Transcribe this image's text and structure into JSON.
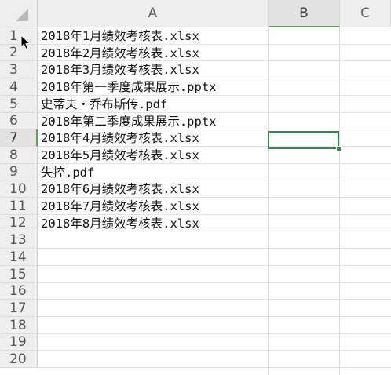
{
  "columns": [
    "A",
    "B",
    "C"
  ],
  "selected_column": "B",
  "rows": [
    {
      "num": "1",
      "a": "2018年1月绩效考核表.xlsx"
    },
    {
      "num": "2",
      "a": "2018年2月绩效考核表.xlsx"
    },
    {
      "num": "3",
      "a": "2018年3月绩效考核表.xlsx"
    },
    {
      "num": "4",
      "a": "2018年第一季度成果展示.pptx"
    },
    {
      "num": "5",
      "a": "史蒂夫・乔布斯传.pdf"
    },
    {
      "num": "6",
      "a": "2018年第二季度成果展示.pptx"
    },
    {
      "num": "7",
      "a": "2018年4月绩效考核表.xlsx"
    },
    {
      "num": "8",
      "a": "2018年5月绩效考核表.xlsx"
    },
    {
      "num": "9",
      "a": "失控.pdf"
    },
    {
      "num": "10",
      "a": "2018年6月绩效考核表.xlsx"
    },
    {
      "num": "11",
      "a": "2018年7月绩效考核表.xlsx"
    },
    {
      "num": "12",
      "a": "2018年8月绩效考核表.xlsx"
    },
    {
      "num": "13",
      "a": ""
    },
    {
      "num": "14",
      "a": ""
    },
    {
      "num": "15",
      "a": ""
    },
    {
      "num": "16",
      "a": ""
    },
    {
      "num": "17",
      "a": ""
    },
    {
      "num": "18",
      "a": ""
    },
    {
      "num": "19",
      "a": ""
    },
    {
      "num": "20",
      "a": ""
    }
  ],
  "selected_cell": {
    "row": "7",
    "column": "B"
  },
  "colors": {
    "selection": "#2f8b4a",
    "header_bg": "#eeeeee",
    "gridline": "#e3e3e3"
  },
  "icons": {
    "corner": "select-all-triangle-icon",
    "cursor": "mouse-pointer-icon"
  }
}
